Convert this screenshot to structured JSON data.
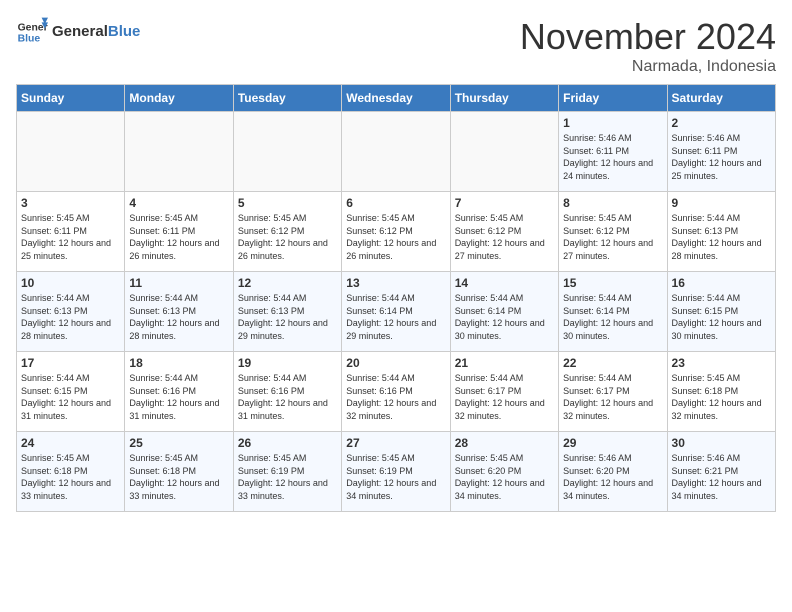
{
  "logo": {
    "text_general": "General",
    "text_blue": "Blue"
  },
  "header": {
    "month": "November 2024",
    "location": "Narmada, Indonesia"
  },
  "weekdays": [
    "Sunday",
    "Monday",
    "Tuesday",
    "Wednesday",
    "Thursday",
    "Friday",
    "Saturday"
  ],
  "weeks": [
    [
      {
        "day": "",
        "info": ""
      },
      {
        "day": "",
        "info": ""
      },
      {
        "day": "",
        "info": ""
      },
      {
        "day": "",
        "info": ""
      },
      {
        "day": "",
        "info": ""
      },
      {
        "day": "1",
        "info": "Sunrise: 5:46 AM\nSunset: 6:11 PM\nDaylight: 12 hours and 24 minutes."
      },
      {
        "day": "2",
        "info": "Sunrise: 5:46 AM\nSunset: 6:11 PM\nDaylight: 12 hours and 25 minutes."
      }
    ],
    [
      {
        "day": "3",
        "info": "Sunrise: 5:45 AM\nSunset: 6:11 PM\nDaylight: 12 hours and 25 minutes."
      },
      {
        "day": "4",
        "info": "Sunrise: 5:45 AM\nSunset: 6:11 PM\nDaylight: 12 hours and 26 minutes."
      },
      {
        "day": "5",
        "info": "Sunrise: 5:45 AM\nSunset: 6:12 PM\nDaylight: 12 hours and 26 minutes."
      },
      {
        "day": "6",
        "info": "Sunrise: 5:45 AM\nSunset: 6:12 PM\nDaylight: 12 hours and 26 minutes."
      },
      {
        "day": "7",
        "info": "Sunrise: 5:45 AM\nSunset: 6:12 PM\nDaylight: 12 hours and 27 minutes."
      },
      {
        "day": "8",
        "info": "Sunrise: 5:45 AM\nSunset: 6:12 PM\nDaylight: 12 hours and 27 minutes."
      },
      {
        "day": "9",
        "info": "Sunrise: 5:44 AM\nSunset: 6:13 PM\nDaylight: 12 hours and 28 minutes."
      }
    ],
    [
      {
        "day": "10",
        "info": "Sunrise: 5:44 AM\nSunset: 6:13 PM\nDaylight: 12 hours and 28 minutes."
      },
      {
        "day": "11",
        "info": "Sunrise: 5:44 AM\nSunset: 6:13 PM\nDaylight: 12 hours and 28 minutes."
      },
      {
        "day": "12",
        "info": "Sunrise: 5:44 AM\nSunset: 6:13 PM\nDaylight: 12 hours and 29 minutes."
      },
      {
        "day": "13",
        "info": "Sunrise: 5:44 AM\nSunset: 6:14 PM\nDaylight: 12 hours and 29 minutes."
      },
      {
        "day": "14",
        "info": "Sunrise: 5:44 AM\nSunset: 6:14 PM\nDaylight: 12 hours and 30 minutes."
      },
      {
        "day": "15",
        "info": "Sunrise: 5:44 AM\nSunset: 6:14 PM\nDaylight: 12 hours and 30 minutes."
      },
      {
        "day": "16",
        "info": "Sunrise: 5:44 AM\nSunset: 6:15 PM\nDaylight: 12 hours and 30 minutes."
      }
    ],
    [
      {
        "day": "17",
        "info": "Sunrise: 5:44 AM\nSunset: 6:15 PM\nDaylight: 12 hours and 31 minutes."
      },
      {
        "day": "18",
        "info": "Sunrise: 5:44 AM\nSunset: 6:16 PM\nDaylight: 12 hours and 31 minutes."
      },
      {
        "day": "19",
        "info": "Sunrise: 5:44 AM\nSunset: 6:16 PM\nDaylight: 12 hours and 31 minutes."
      },
      {
        "day": "20",
        "info": "Sunrise: 5:44 AM\nSunset: 6:16 PM\nDaylight: 12 hours and 32 minutes."
      },
      {
        "day": "21",
        "info": "Sunrise: 5:44 AM\nSunset: 6:17 PM\nDaylight: 12 hours and 32 minutes."
      },
      {
        "day": "22",
        "info": "Sunrise: 5:44 AM\nSunset: 6:17 PM\nDaylight: 12 hours and 32 minutes."
      },
      {
        "day": "23",
        "info": "Sunrise: 5:45 AM\nSunset: 6:18 PM\nDaylight: 12 hours and 32 minutes."
      }
    ],
    [
      {
        "day": "24",
        "info": "Sunrise: 5:45 AM\nSunset: 6:18 PM\nDaylight: 12 hours and 33 minutes."
      },
      {
        "day": "25",
        "info": "Sunrise: 5:45 AM\nSunset: 6:18 PM\nDaylight: 12 hours and 33 minutes."
      },
      {
        "day": "26",
        "info": "Sunrise: 5:45 AM\nSunset: 6:19 PM\nDaylight: 12 hours and 33 minutes."
      },
      {
        "day": "27",
        "info": "Sunrise: 5:45 AM\nSunset: 6:19 PM\nDaylight: 12 hours and 34 minutes."
      },
      {
        "day": "28",
        "info": "Sunrise: 5:45 AM\nSunset: 6:20 PM\nDaylight: 12 hours and 34 minutes."
      },
      {
        "day": "29",
        "info": "Sunrise: 5:46 AM\nSunset: 6:20 PM\nDaylight: 12 hours and 34 minutes."
      },
      {
        "day": "30",
        "info": "Sunrise: 5:46 AM\nSunset: 6:21 PM\nDaylight: 12 hours and 34 minutes."
      }
    ]
  ]
}
